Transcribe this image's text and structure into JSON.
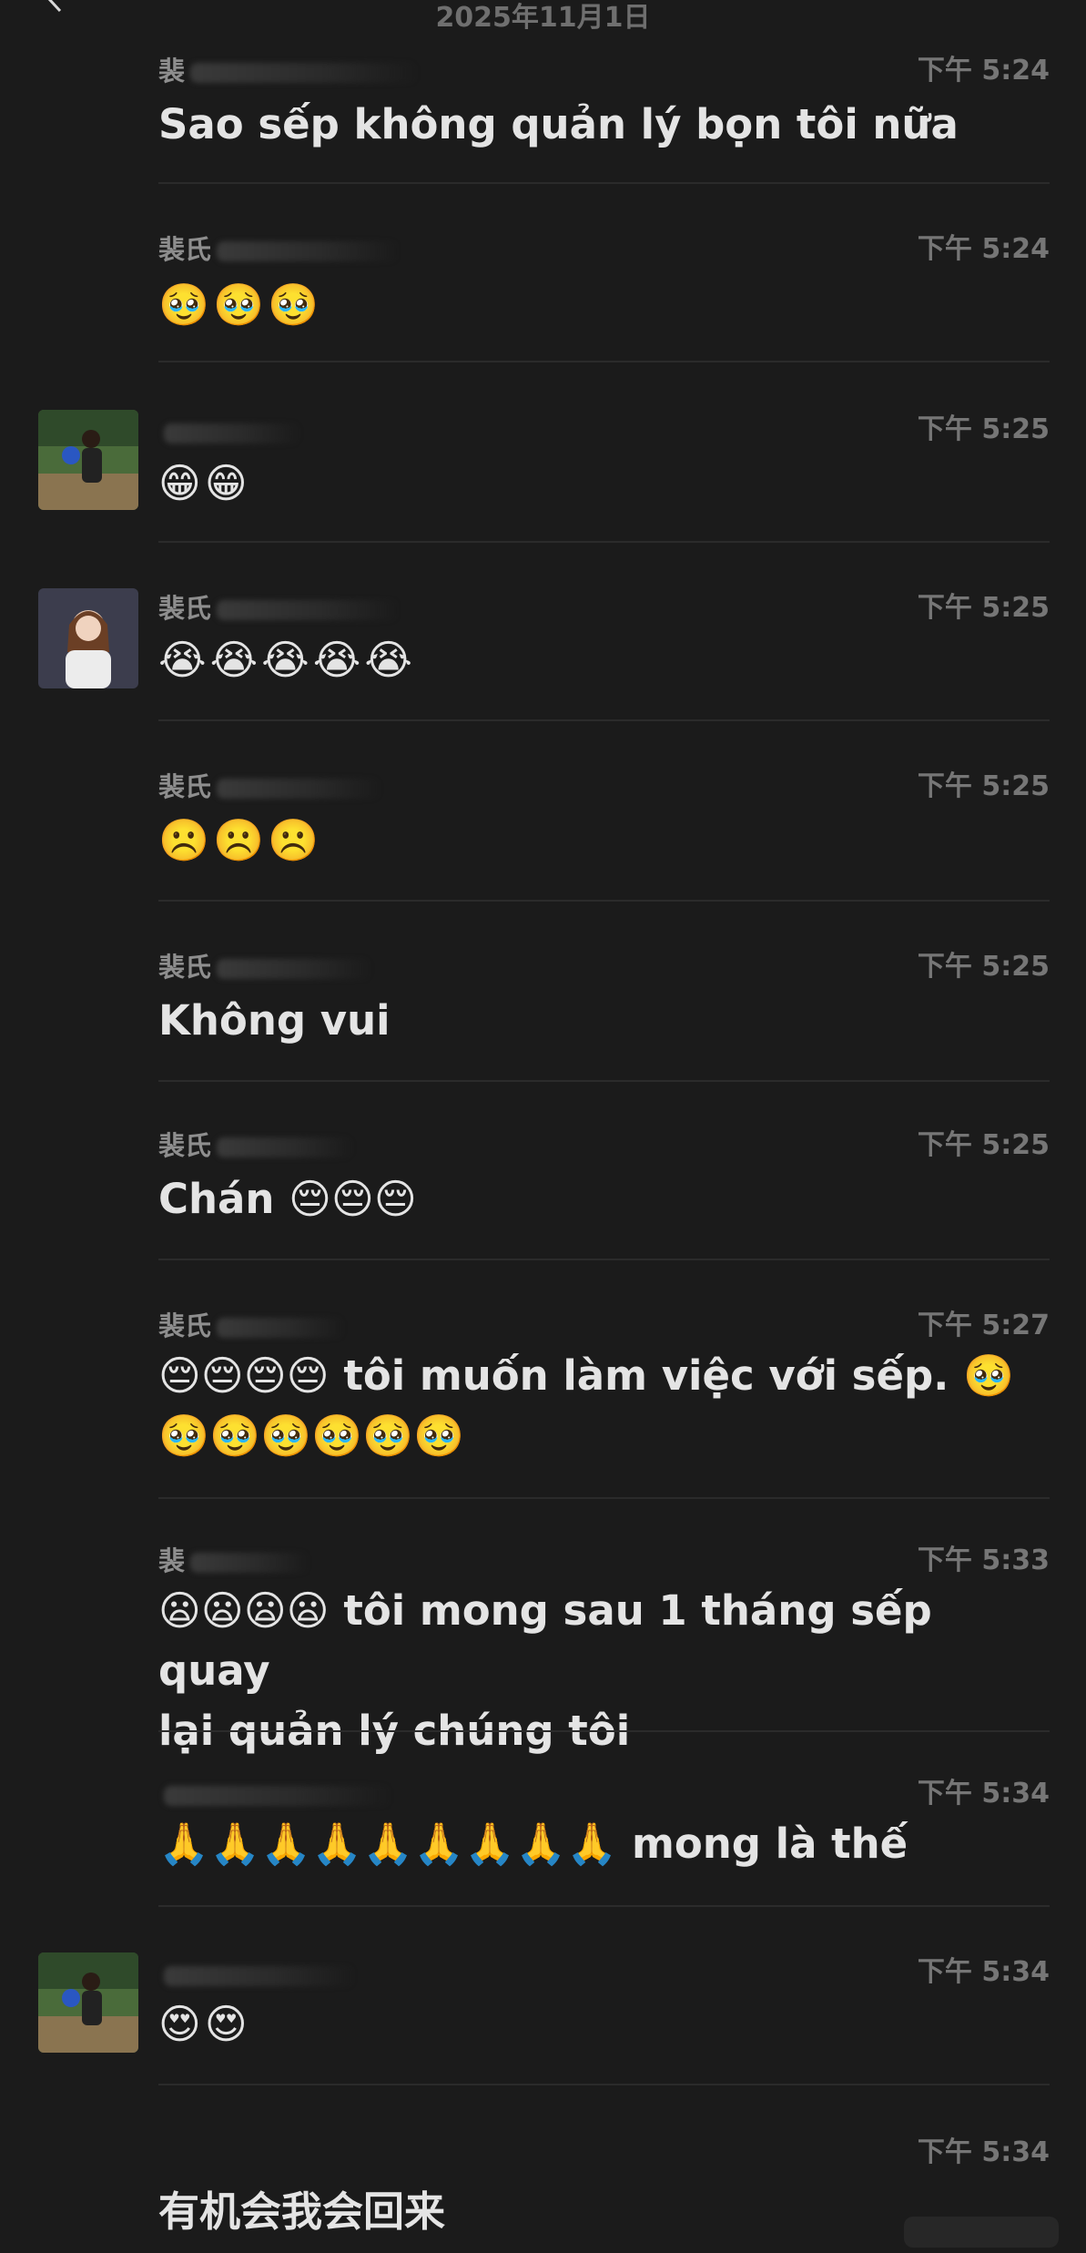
{
  "header": {
    "date": "2025年11月1日",
    "back_icon": "chevron-left-icon"
  },
  "messages": [
    {
      "sender": "裴",
      "time": "下午 5:24",
      "text": "Sao sếp không quản lý bọn tôi nữa",
      "avatar": false
    },
    {
      "sender": "裴氏",
      "time": "下午 5:24",
      "text": "🥹🥹🥹",
      "avatar": false
    },
    {
      "sender": "",
      "time": "下午 5:25",
      "text": "😁😁",
      "avatar": true
    },
    {
      "sender": "裴氏",
      "time": "下午 5:25",
      "text": "😭😭😭😭😭",
      "avatar": true
    },
    {
      "sender": "裴氏",
      "time": "下午 5:25",
      "text": "☹️☹️☹️",
      "avatar": false
    },
    {
      "sender": "裴氏",
      "time": "下午 5:25",
      "text": "Không vui",
      "avatar": false
    },
    {
      "sender": "裴氏",
      "time": "下午 5:25",
      "text": "Chán 😔😔😔",
      "avatar": false
    },
    {
      "sender": "裴氏",
      "time": "下午 5:27",
      "text": "😔😔😔😔 tôi muốn làm việc với sếp. 🥹\n🥹🥹🥹🥹🥹🥹",
      "avatar": false
    },
    {
      "sender": "裴",
      "time": "下午 5:33",
      "text": "😦😦😦😦 tôi mong sau 1 tháng sếp quay\nlại quản lý chúng tôi",
      "avatar": false
    },
    {
      "sender": "",
      "time": "下午 5:34",
      "text": "🙏🙏🙏🙏🙏🙏🙏🙏🙏 mong là thế",
      "avatar": false
    },
    {
      "sender": "",
      "time": "下午 5:34",
      "text": "😍😍",
      "avatar": true
    },
    {
      "sender": "",
      "time": "下午 5:34",
      "text": "有机会我会回来",
      "avatar": false
    }
  ],
  "colors": {
    "background": "#1b1b1b",
    "text": "#e4e4e4",
    "meta": "#767676",
    "divider": "#2b2b2b"
  }
}
